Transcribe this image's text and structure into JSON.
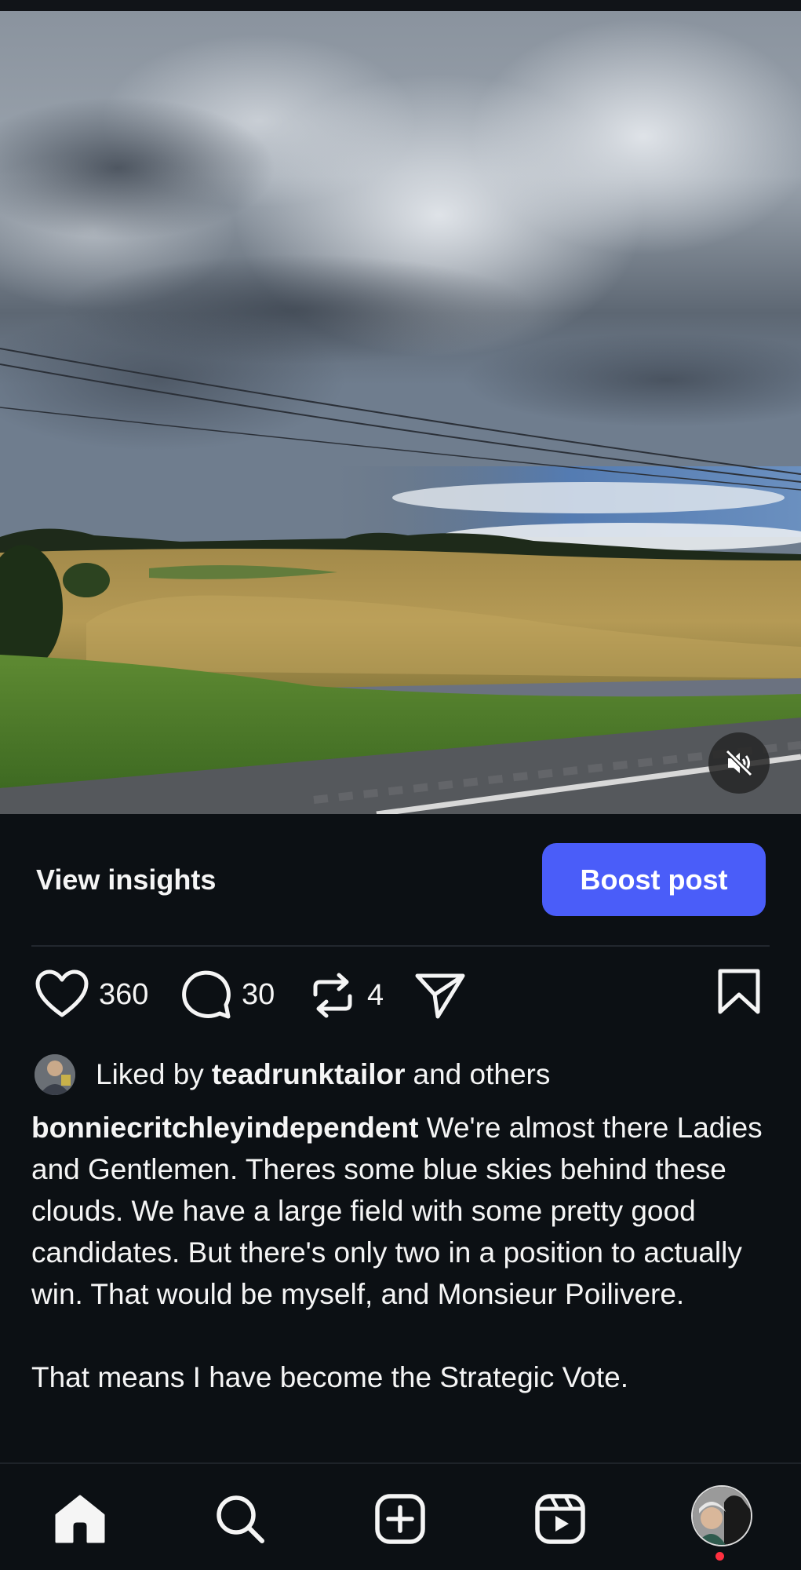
{
  "post": {
    "media": {
      "type": "video",
      "sound": "muted"
    },
    "insights_label": "View insights",
    "boost_label": "Boost post",
    "likes_count": "360",
    "comments_count": "30",
    "reposts_count": "4",
    "liked_by_prefix": "Liked by",
    "liked_by_user": "teadrunktailor",
    "liked_by_suffix": "and others",
    "author": "bonniecritchleyindependent",
    "caption": " We're almost there Ladies and Gentlemen. Theres some blue skies behind these clouds. We have a large field with some pretty good candidates. But there's only two in a position to actually win. That would be myself, and Monsieur Poilivere.\n\nThat means I have become the Strategic Vote."
  },
  "nav": {
    "items": [
      "home-icon",
      "search-icon",
      "create-icon",
      "reels-icon",
      "profile-avatar"
    ],
    "active": "home",
    "notification_dot_color": "#ff3040"
  },
  "colors": {
    "background": "#0c1014",
    "boost_button": "#4a5df9",
    "text": "#f5f5f5"
  }
}
